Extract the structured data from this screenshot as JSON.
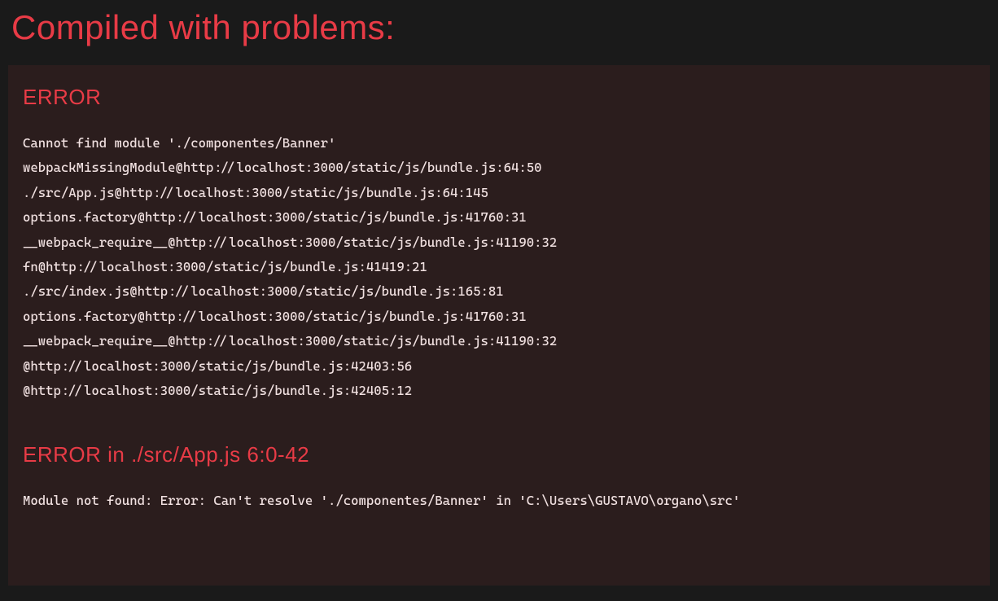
{
  "header": {
    "title": "Compiled with problems:"
  },
  "errors": [
    {
      "title": "ERROR",
      "body": "Cannot find module './componentes/Banner'\nwebpackMissingModule@http://localhost:3000/static/js/bundle.js:64:50\n./src/App.js@http://localhost:3000/static/js/bundle.js:64:145\noptions.factory@http://localhost:3000/static/js/bundle.js:41760:31\n__webpack_require__@http://localhost:3000/static/js/bundle.js:41190:32\nfn@http://localhost:3000/static/js/bundle.js:41419:21\n./src/index.js@http://localhost:3000/static/js/bundle.js:165:81\noptions.factory@http://localhost:3000/static/js/bundle.js:41760:31\n__webpack_require__@http://localhost:3000/static/js/bundle.js:41190:32\n@http://localhost:3000/static/js/bundle.js:42403:56\n@http://localhost:3000/static/js/bundle.js:42405:12"
    },
    {
      "title": "ERROR in ./src/App.js 6:0-42",
      "body": "Module not found: Error: Can't resolve './componentes/Banner' in 'C:\\Users\\GUSTAVO\\organo\\src'"
    }
  ]
}
